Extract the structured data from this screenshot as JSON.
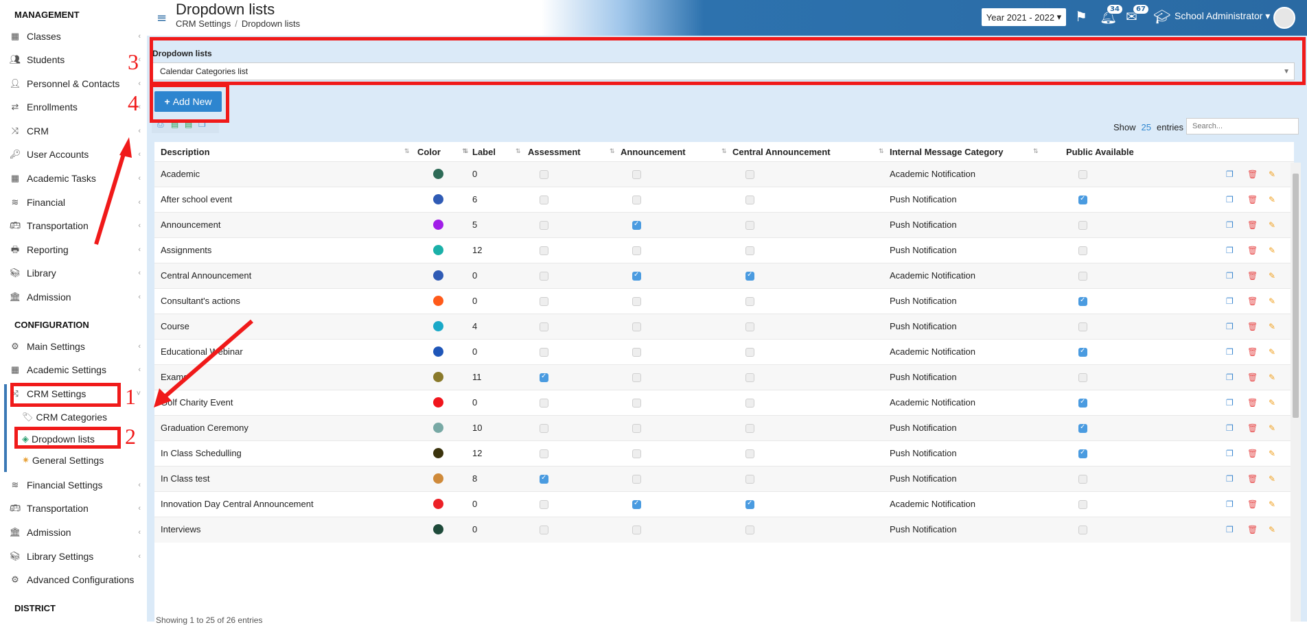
{
  "header": {
    "title": "Dropdown lists",
    "breadcrumb": [
      "CRM Settings",
      "Dropdown lists"
    ],
    "year": "Year 2021 - 2022",
    "notifications": "34",
    "messages": "67",
    "user": "School Administrator"
  },
  "sidebar": {
    "management_title": "MANAGEMENT",
    "management_items": [
      "Classes",
      "Students",
      "Personnel & Contacts",
      "Enrollments",
      "CRM",
      "User Accounts",
      "Academic Tasks",
      "Financial",
      "Transportation",
      "Reporting",
      "Library",
      "Admission"
    ],
    "configuration_title": "CONFIGURATION",
    "configuration_items_top": [
      "Main Settings",
      "Academic Settings",
      "CRM Settings"
    ],
    "crm_sub": [
      "CRM Categories",
      "Dropdown lists",
      "General Settings"
    ],
    "configuration_items_bottom": [
      "Financial Settings",
      "Transportation",
      "Admission",
      "Library Settings",
      "Advanced Configurations"
    ],
    "district_title": "DISTRICT"
  },
  "panel": {
    "label": "Dropdown lists",
    "selected": "Calendar Categories list",
    "add_button": "Add New",
    "show_label": "Show",
    "entries_count": "25",
    "entries_label": "entries",
    "search_placeholder": "Search..."
  },
  "table": {
    "columns": [
      "Description",
      "Color",
      "Label",
      "Assessment",
      "Announcement",
      "Central Announcement",
      "Internal Message Category",
      "Public Available"
    ],
    "rows": [
      {
        "description": "Academic",
        "color": "#2e6b57",
        "label": "0",
        "assessment": false,
        "announcement": false,
        "central": false,
        "category": "Academic Notification",
        "public": false
      },
      {
        "description": "After school event",
        "color": "#2f5bb5",
        "label": "6",
        "assessment": false,
        "announcement": false,
        "central": false,
        "category": "Push Notification",
        "public": true
      },
      {
        "description": "Announcement",
        "color": "#a11ee8",
        "label": "5",
        "assessment": false,
        "announcement": true,
        "central": false,
        "category": "Push Notification",
        "public": false
      },
      {
        "description": "Assignments",
        "color": "#1ab0a8",
        "label": "12",
        "assessment": false,
        "announcement": false,
        "central": false,
        "category": "Push Notification",
        "public": false
      },
      {
        "description": "Central Announcement",
        "color": "#2f5bb5",
        "label": "0",
        "assessment": false,
        "announcement": true,
        "central": true,
        "category": "Academic Notification",
        "public": false
      },
      {
        "description": "Consultant's actions",
        "color": "#ff5a1a",
        "label": "0",
        "assessment": false,
        "announcement": false,
        "central": false,
        "category": "Push Notification",
        "public": true
      },
      {
        "description": "Course",
        "color": "#1aa9c8",
        "label": "4",
        "assessment": false,
        "announcement": false,
        "central": false,
        "category": "Push Notification",
        "public": false
      },
      {
        "description": "Educational Webinar",
        "color": "#1f56b8",
        "label": "0",
        "assessment": false,
        "announcement": false,
        "central": false,
        "category": "Academic Notification",
        "public": true
      },
      {
        "description": "Exams",
        "color": "#8a7a2b",
        "label": "11",
        "assessment": true,
        "announcement": false,
        "central": false,
        "category": "Push Notification",
        "public": false
      },
      {
        "description": "Golf Charity Event",
        "color": "#f0151c",
        "label": "0",
        "assessment": false,
        "announcement": false,
        "central": false,
        "category": "Academic Notification",
        "public": true
      },
      {
        "description": "Graduation Ceremony",
        "color": "#78a9a5",
        "label": "10",
        "assessment": false,
        "announcement": false,
        "central": false,
        "category": "Push Notification",
        "public": true
      },
      {
        "description": "In Class Schedulling",
        "color": "#3b330d",
        "label": "12",
        "assessment": false,
        "announcement": false,
        "central": false,
        "category": "Push Notification",
        "public": true
      },
      {
        "description": "In Class test",
        "color": "#cf8a3a",
        "label": "8",
        "assessment": true,
        "announcement": false,
        "central": false,
        "category": "Push Notification",
        "public": false
      },
      {
        "description": "Innovation Day Central Announcement",
        "color": "#ec2127",
        "label": "0",
        "assessment": false,
        "announcement": true,
        "central": true,
        "category": "Academic Notification",
        "public": false
      },
      {
        "description": "Interviews",
        "color": "#1e4a3a",
        "label": "0",
        "assessment": false,
        "announcement": false,
        "central": false,
        "category": "Push Notification",
        "public": false
      }
    ],
    "footer": "Showing 1 to 25 of 26 entries"
  },
  "annotations": [
    "1",
    "2",
    "3",
    "4"
  ],
  "colors": {
    "accent": "#2d85cf",
    "annotation": "#f01a1a",
    "header": "#2a6aa3"
  }
}
